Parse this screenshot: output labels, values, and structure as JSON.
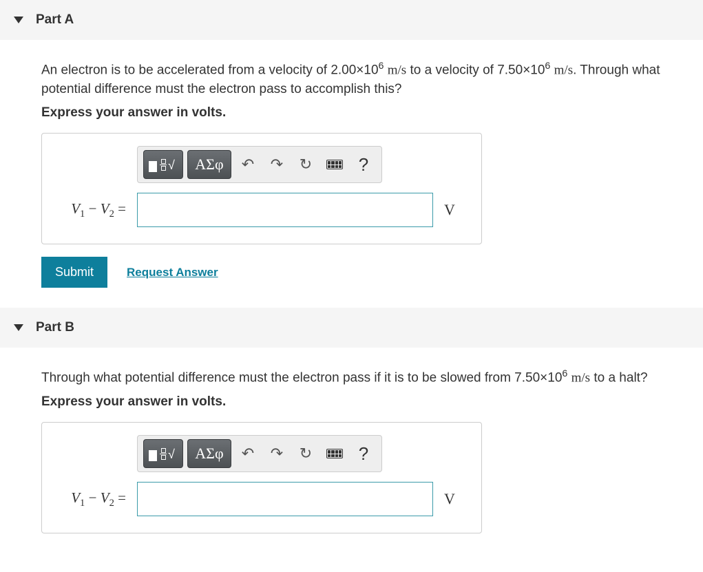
{
  "parts": [
    {
      "title": "Part A",
      "question_html": "An electron is to be accelerated from a velocity of 2.00×10<span class='sup'>6</span> <span class='math'>m/s</span> to a velocity of 7.50×10<span class='sup'>6</span> <span class='math'>m/s</span>. Through what potential difference must the electron pass to accomplish this?",
      "instruction": "Express your answer in volts.",
      "toolbar": {
        "greek_label": "ΑΣφ",
        "help_label": "?"
      },
      "lhs_html": "<i>V</i><span class='sub'>1</span> − <i>V</i><span class='sub'>2</span> =",
      "input_value": "",
      "unit": "V",
      "submit_label": "Submit",
      "request_label": "Request Answer",
      "show_actions": true
    },
    {
      "title": "Part B",
      "question_html": "Through what potential difference must the electron pass if it is to be slowed from 7.50×10<span class='sup'>6</span> <span class='math'>m/s</span> to a halt?",
      "instruction": "Express your answer in volts.",
      "toolbar": {
        "greek_label": "ΑΣφ",
        "help_label": "?"
      },
      "lhs_html": "<i>V</i><span class='sub'>1</span> − <i>V</i><span class='sub'>2</span> =",
      "input_value": "",
      "unit": "V",
      "submit_label": "Submit",
      "request_label": "Request Answer",
      "show_actions": false
    }
  ]
}
